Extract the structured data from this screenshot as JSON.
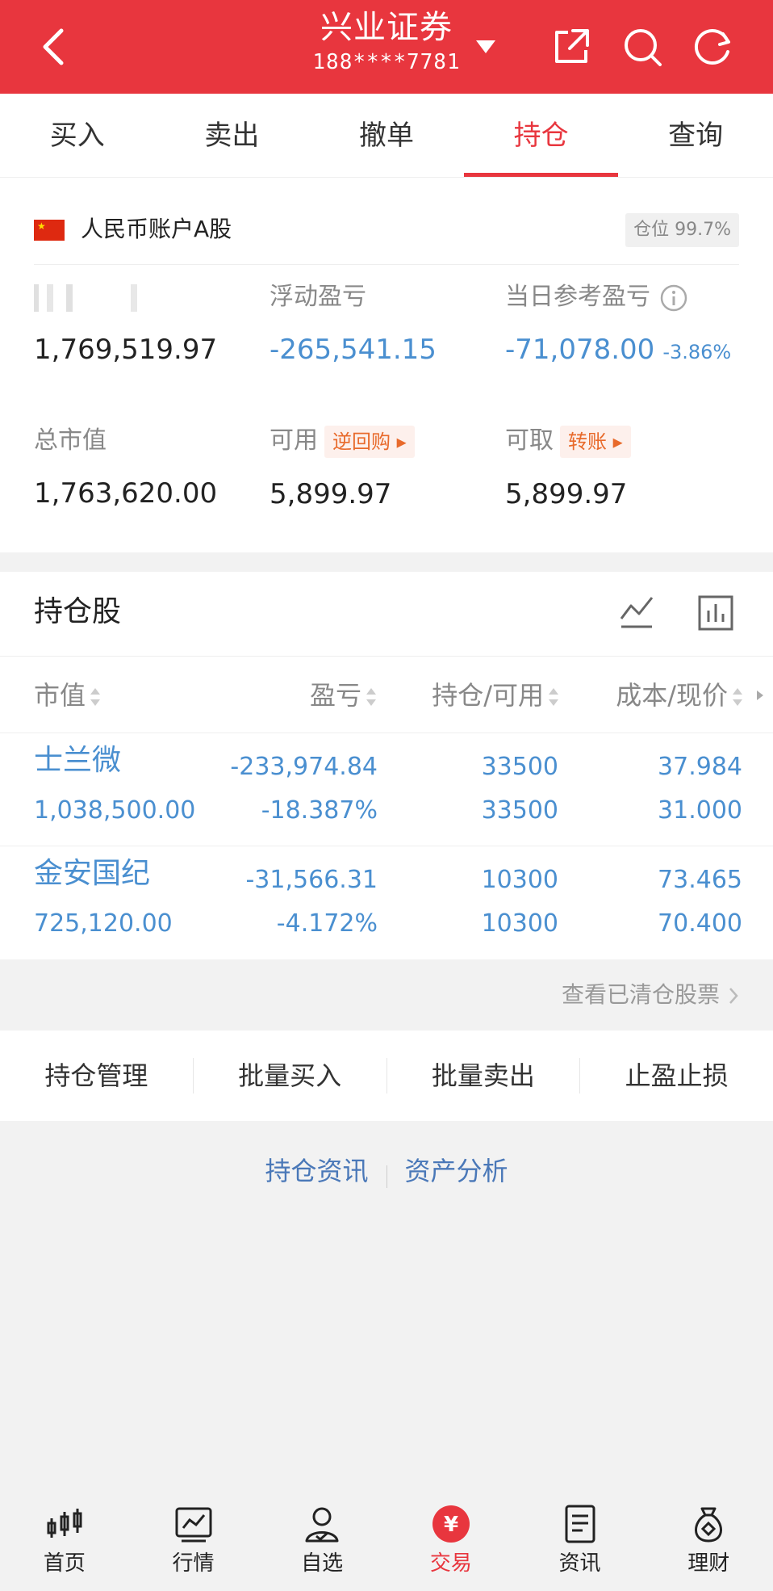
{
  "header": {
    "title": "兴业证券",
    "account": "188****7781"
  },
  "tabs": [
    {
      "label": "买入"
    },
    {
      "label": "卖出"
    },
    {
      "label": "撤单"
    },
    {
      "label": "持仓",
      "active": true
    },
    {
      "label": "查询"
    }
  ],
  "account_panel": {
    "account_label": "人民币账户A股",
    "position_badge": "仓位 99.7%",
    "total_assets": {
      "label": "",
      "value": "1,769,519.97"
    },
    "floating_pl": {
      "label": "浮动盈亏",
      "value": "-265,541.15"
    },
    "daily_pl": {
      "label": "当日参考盈亏",
      "value": "-71,078.00",
      "pct": "-3.86%"
    },
    "market_value": {
      "label": "总市值",
      "value": "1,763,620.00"
    },
    "available": {
      "label": "可用",
      "pill": "逆回购",
      "value": "5,899.97"
    },
    "withdrawable": {
      "label": "可取",
      "pill": "转账",
      "value": "5,899.97"
    }
  },
  "holdings": {
    "title": "持仓股",
    "columns": [
      "市值",
      "盈亏",
      "持仓/可用",
      "成本/现价"
    ],
    "rows": [
      {
        "name": "士兰微",
        "market_value": "1,038,500.00",
        "pl": "-233,974.84",
        "pl_pct": "-18.387%",
        "position": "33500",
        "available": "33500",
        "cost": "37.984",
        "price": "31.000"
      },
      {
        "name": "金安国纪",
        "market_value": "725,120.00",
        "pl": "-31,566.31",
        "pl_pct": "-4.172%",
        "position": "10300",
        "available": "10300",
        "cost": "73.465",
        "price": "70.400"
      }
    ],
    "cleared_link": "查看已清仓股票"
  },
  "actions": [
    "持仓管理",
    "批量买入",
    "批量卖出",
    "止盈止损"
  ],
  "links": [
    "持仓资讯",
    "资产分析"
  ],
  "bottom_nav": [
    {
      "label": "首页",
      "icon": "candlestick-icon"
    },
    {
      "label": "行情",
      "icon": "chart-icon"
    },
    {
      "label": "自选",
      "icon": "person-check-icon"
    },
    {
      "label": "交易",
      "icon": "yuan-icon",
      "active": true
    },
    {
      "label": "资讯",
      "icon": "document-icon"
    },
    {
      "label": "理财",
      "icon": "money-bag-icon"
    }
  ],
  "colors": {
    "brand": "#e8363e",
    "value_blue": "#4a8fd0",
    "link_blue": "#4a78b8"
  }
}
